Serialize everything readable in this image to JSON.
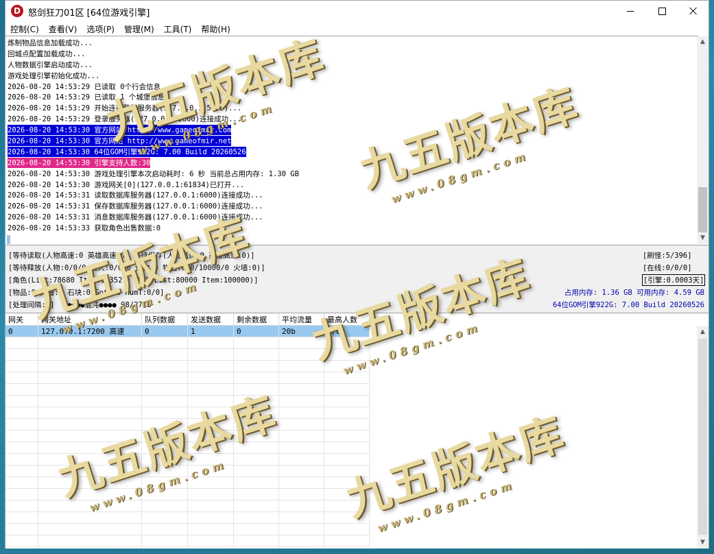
{
  "window": {
    "app_icon_letter": "D",
    "title": "怒剑狂刀01区 [64位游戏引擎]"
  },
  "menu": [
    "控制(C)",
    "查看(V)",
    "选项(P)",
    "管理(M)",
    "工具(T)",
    "帮助(H)"
  ],
  "log": [
    {
      "text": "炼制物品信息加载成功..."
    },
    {
      "text": "回城点配置加载成功..."
    },
    {
      "text": "人物数据引擎启动成功..."
    },
    {
      "text": "游戏处理引擎初始化成功..."
    },
    {
      "text": "2026-08-20 14:53:29 已读取 0个行会信息..."
    },
    {
      "text": "2026-08-20 14:53:29 已读取 1 个城堡信息"
    },
    {
      "text": "2026-08-20 14:53:29 开始连接登录服务器(127.0.0.1:5600)..."
    },
    {
      "text": "2026-08-20 14:53:29 登录服务器(127.0.0.1:5600)连接成功..."
    },
    {
      "text": "2026-08-20 14:53:30 官方网站 http://www.gameofmir.com",
      "hl": "blue"
    },
    {
      "text": "2026-08-20 14:53:30 官方网站 http://www.gameofmir.net",
      "hl": "blue"
    },
    {
      "text": "2026-08-20 14:53:30 64位GOM引擎922G: 7.00 Build 20260526",
      "hl": "blue"
    },
    {
      "text": "2026-08-20 14:53:30 引擎支持人数:30",
      "hl": "pink"
    },
    {
      "text": "2026-08-20 14:53:30 游戏处理引擎本次启动耗时: 6 秒 当前总占用内存: 1.30 GB"
    },
    {
      "text": "2026-08-20 14:53:30 游戏网关[0](127.0.0.1:61834)已打开..."
    },
    {
      "text": "2026-08-20 14:53:31 读取数据库服务器(127.0.0.1:6000)连接成功..."
    },
    {
      "text": "2026-08-20 14:53:31 保存数据库服务器(127.0.0.1:6000)连接成功..."
    },
    {
      "text": "2026-08-20 14:53:31 消息数据库服务器(127.0.0.1:6000)连接成功..."
    },
    {
      "text": "2026-08-20 14:53:33 获取角色出售数据:0"
    }
  ],
  "status": {
    "line1": "[等待读取(人物高速:0 英雄高速:0) 等待保存(人物高速:0 英雄高速:0)]",
    "line2": "[等待释放(人物:0/0/0 假人:0/0/0 怪物:0 物品:0/0/10000/0 火墙:0)]",
    "line3": "[角色(List:78680 Item:103527) 物品(List:80000 Item:100000)]",
    "line4": "[物品:0 火墙:0 石块:0 Goto:0 HumT:0/0]",
    "line5": "[处理间隔:0]   ●●●●混沌●●●● 98/2718",
    "right1": "[刷怪:5/396]",
    "right2": "[在线:0/0/0]",
    "right3": "[引擎:0.0003天]",
    "memory": "占用内存: 1.36 GB 可用内存: 4.59 GB",
    "version": "64位GOM引擎922G: 7.00 Build 20260526"
  },
  "gateway": {
    "headers": [
      "网关",
      "网关地址",
      "队列数据",
      "发送数据",
      "剩余数据",
      "平均流量",
      "最高人数"
    ],
    "rows": [
      [
        "0",
        "127.0.0.1:7200 高速",
        "0",
        "1",
        "0",
        "20b",
        "0/0"
      ]
    ]
  },
  "watermark": {
    "big": "九五版本库",
    "small": "www.08gm.com"
  }
}
